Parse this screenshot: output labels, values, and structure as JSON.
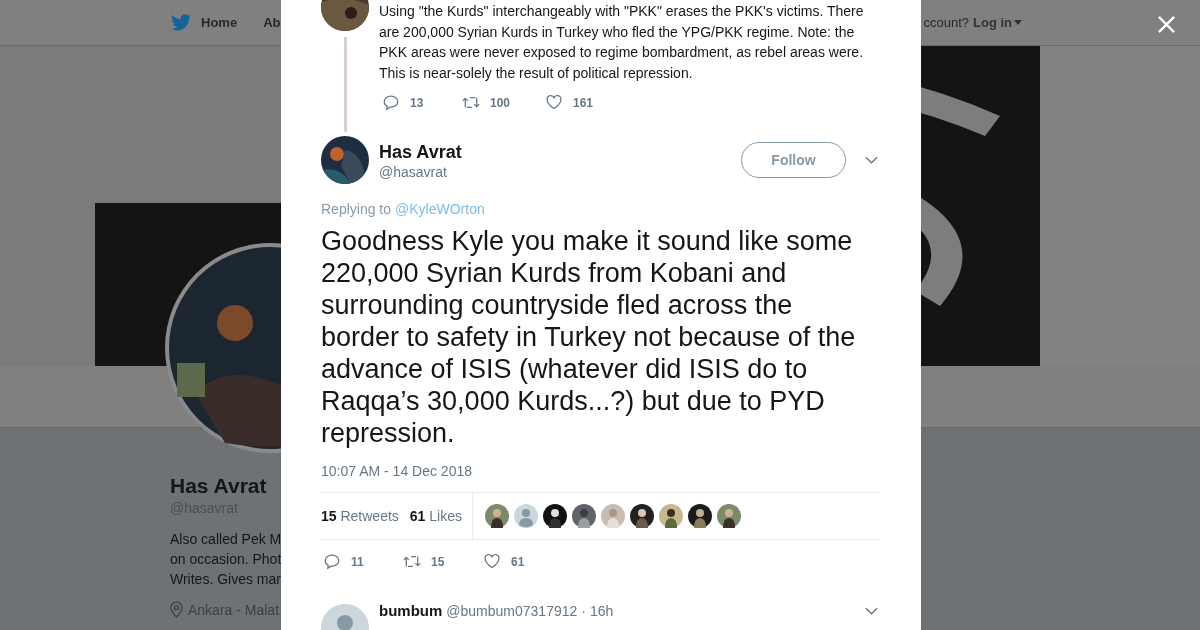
{
  "background_page": {
    "nav": {
      "home": "Home",
      "about": "Ab",
      "login_prompt": "ccount?",
      "login": "Log in"
    },
    "banner": {
      "kind": "picture"
    },
    "profile": {
      "avatar": {
        "kind": "picture"
      },
      "name": "Has Avrat",
      "handle": "@hasavrat",
      "bio_lines": [
        "Also called Pek M",
        "on occasion. Phot",
        "Writes. Gives mar"
      ],
      "location": "Ankara - Malat"
    }
  },
  "modal": {
    "parent_tweet": {
      "avatar": {
        "kind": "picture"
      },
      "text": "Using \"the Kurds\" interchangeably with \"PKK\" erases the PKK's victims. There are 200,000 Syrian Kurds in Turkey who fled the YPG/PKK regime. Note: the PKK areas were never exposed to regime bombardment, as rebel areas were. This is near-solely the result of political repression.",
      "actions": [
        {
          "kind": "reply",
          "count": "13"
        },
        {
          "kind": "retweet",
          "count": "100"
        },
        {
          "kind": "like",
          "count": "161"
        }
      ]
    },
    "tweet": {
      "avatar": {
        "kind": "picture"
      },
      "name": "Has Avrat",
      "handle": "@hasavrat",
      "follow_button": "Follow",
      "replying_label": "Replying to",
      "replying_to": "@KyleWOrton",
      "text": "Goodness Kyle you make it sound like some 220,000 Syrian Kurds from Kobani and surrounding countryside fled across the border to safety in Turkey not because of the advance of ISIS (whatever did ISIS do to Raqqa’s 30,000 Kurds...?) but due to PYD repression.",
      "timestamp": "10:07 AM - 14 Dec 2018",
      "retweets_count": "15",
      "retweets_label": "Retweets",
      "likes_count": "61",
      "likes_label": "Likes",
      "liker_avatars": [
        {
          "kind": "picture"
        },
        {
          "kind": "default"
        },
        {
          "kind": "picture"
        },
        {
          "kind": "picture"
        },
        {
          "kind": "picture"
        },
        {
          "kind": "picture"
        },
        {
          "kind": "picture"
        },
        {
          "kind": "picture"
        },
        {
          "kind": "picture"
        }
      ],
      "actions": [
        {
          "kind": "reply",
          "count": "11"
        },
        {
          "kind": "retweet",
          "count": "15"
        },
        {
          "kind": "like",
          "count": "61"
        }
      ]
    },
    "reply": {
      "avatar": {
        "kind": "default"
      },
      "name": "bumbum",
      "handle": "@bumbum07317912",
      "separator": "·",
      "time": "16h"
    }
  }
}
